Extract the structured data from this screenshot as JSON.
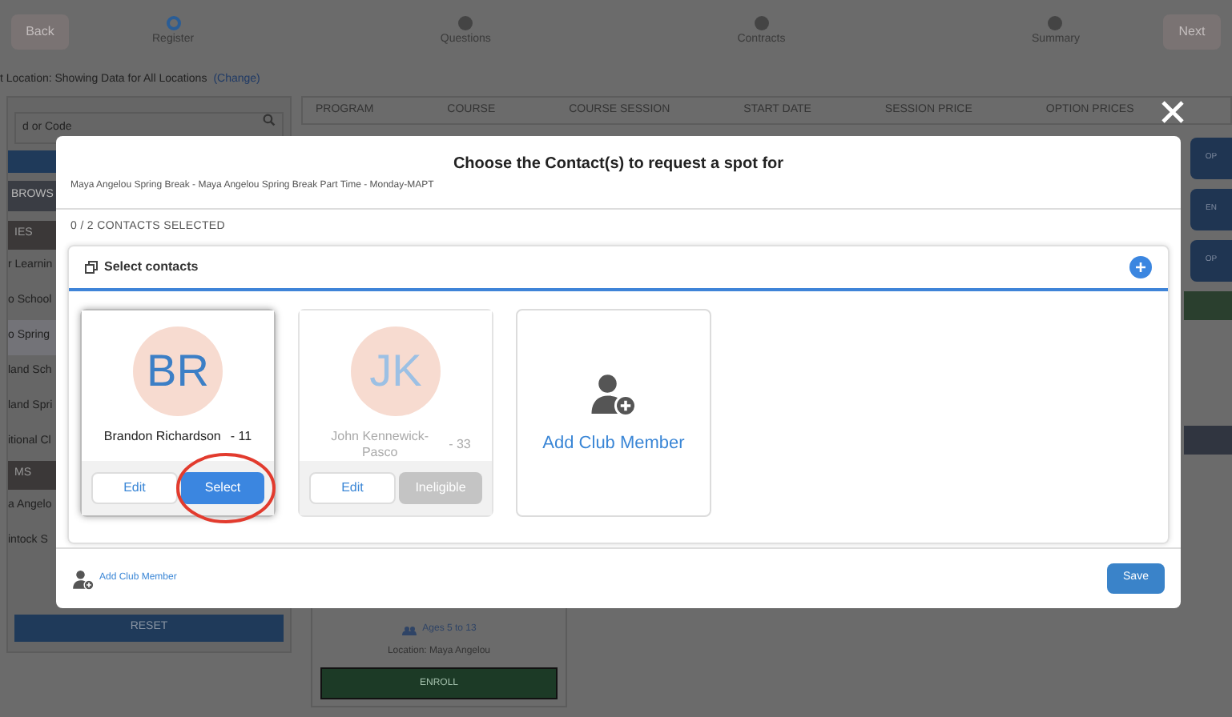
{
  "stepper": {
    "back": "Back",
    "next": "Next",
    "steps": [
      {
        "label": "Register",
        "selected": true
      },
      {
        "label": "Questions",
        "selected": false
      },
      {
        "label": "Contracts",
        "selected": false
      },
      {
        "label": "Summary",
        "selected": false
      }
    ]
  },
  "location": {
    "text": "t Location: Showing Data for All Locations",
    "link": "(Change)"
  },
  "sidebar": {
    "search_placeholder": "d or Code",
    "tab": "BROWS",
    "sections": [
      {
        "header": "IES",
        "items": [
          {
            "label": "r Learnin",
            "selected": false
          },
          {
            "label": "o School",
            "selected": false
          },
          {
            "label": "o Spring",
            "selected": true
          },
          {
            "label": "land Sch",
            "selected": false
          },
          {
            "label": "land Spri",
            "selected": false
          },
          {
            "label": "itional Cl",
            "selected": false
          }
        ]
      },
      {
        "header": "MS",
        "items": [
          {
            "label": "a Angelo",
            "selected": false
          },
          {
            "label": "intock S",
            "selected": false
          }
        ]
      }
    ],
    "reset": "RESET"
  },
  "table": {
    "columns": [
      "PROGRAM",
      "COURSE",
      "COURSE SESSION",
      "START DATE",
      "SESSION PRICE",
      "OPTION PRICES"
    ]
  },
  "side_buttons": [
    "OP",
    "EN",
    "OP"
  ],
  "program_card": {
    "ages": "Ages 5 to 13",
    "location": "Location: Maya Angelou",
    "enroll": "ENROLL"
  },
  "dialog": {
    "title": "Choose the Contact(s) to request a spot for",
    "subtitle": "Maya Angelou Spring Break - Maya Angelou Spring Break Part Time - Monday-MAPT",
    "count": "0 / 2 CONTACTS SELECTED",
    "panel_title": "Select contacts",
    "cards": [
      {
        "kind": "contact",
        "initials": "BR",
        "name": "Brandon Richardson",
        "age": "- 11",
        "eligible": true,
        "circled": true,
        "edit": "Edit",
        "action": "Select"
      },
      {
        "kind": "contact",
        "initials": "JK",
        "name": "John Kennewick-Pasco",
        "age": "- 33",
        "eligible": false,
        "circled": false,
        "edit": "Edit",
        "action": "Ineligible"
      },
      {
        "kind": "add",
        "label": "Add Club Member"
      }
    ],
    "footer_link": "Add Club Member",
    "save": "Save"
  }
}
